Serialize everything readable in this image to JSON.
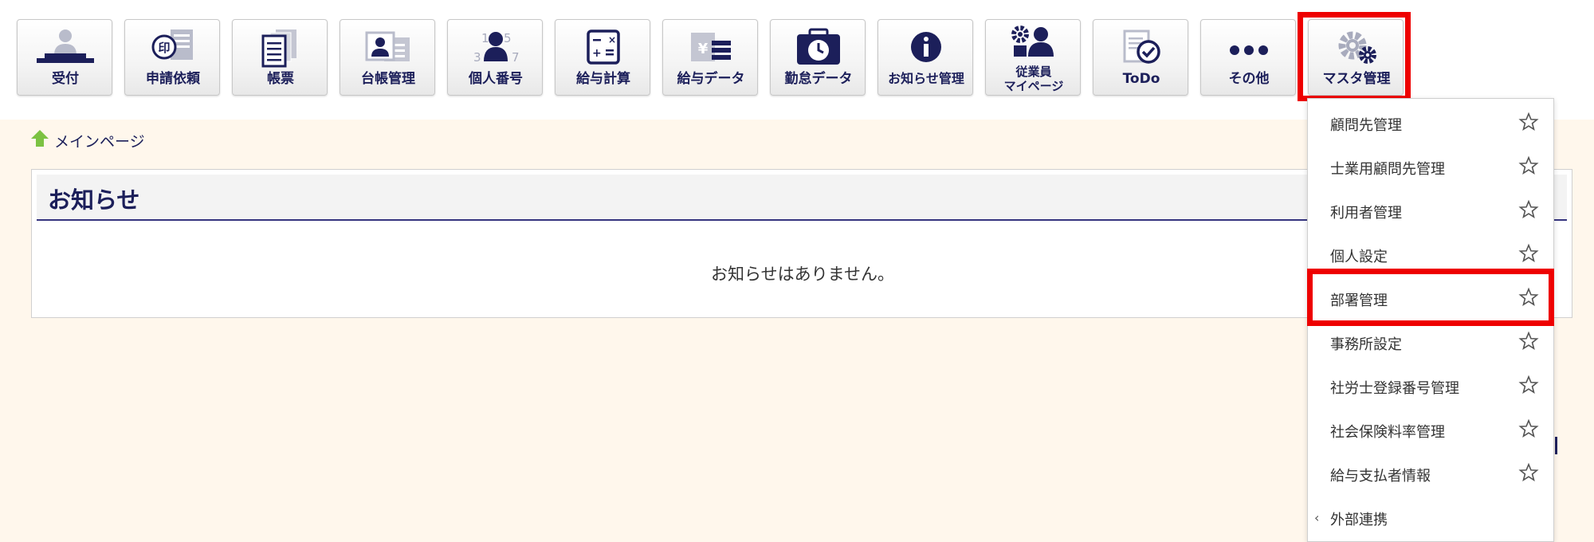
{
  "toolbar": {
    "buttons": [
      {
        "id": "uketsuke",
        "label": "受付",
        "icon": "reception-person-icon"
      },
      {
        "id": "shinsei",
        "label": "申請依頼",
        "icon": "stamp-document-icon"
      },
      {
        "id": "chohyo",
        "label": "帳票",
        "icon": "document-stack-icon"
      },
      {
        "id": "daicho",
        "label": "台帳管理",
        "icon": "id-card-icon"
      },
      {
        "id": "kojin",
        "label": "個人番号",
        "icon": "person-number-icon"
      },
      {
        "id": "kyuyo_keisan",
        "label": "給与計算",
        "icon": "calculator-icon"
      },
      {
        "id": "kyuyo_data",
        "label": "給与データ",
        "icon": "yen-data-icon"
      },
      {
        "id": "kintai",
        "label": "勤怠データ",
        "icon": "clock-bag-icon"
      },
      {
        "id": "oshirase",
        "label": "お知らせ管理",
        "icon": "info-icon"
      },
      {
        "id": "employee",
        "label": "従業員",
        "label2": "マイページ",
        "icon": "employee-gear-icon"
      },
      {
        "id": "todo",
        "label": "ToDo",
        "icon": "todo-check-icon"
      },
      {
        "id": "sonota",
        "label": "その他",
        "icon": "more-dots-icon"
      },
      {
        "id": "master",
        "label": "マスタ管理",
        "icon": "gears-icon"
      }
    ]
  },
  "breadcrumb": {
    "home_label": "メインページ"
  },
  "notice": {
    "title": "お知らせ",
    "empty_message": "お知らせはありません。"
  },
  "dropdown": {
    "items": [
      {
        "label": "顧問先管理"
      },
      {
        "label": "士業用顧問先管理"
      },
      {
        "label": "利用者管理"
      },
      {
        "label": "個人設定"
      },
      {
        "label": "部署管理"
      },
      {
        "label": "事務所設定"
      },
      {
        "label": "社労士登録番号管理"
      },
      {
        "label": "社会保険料率管理"
      },
      {
        "label": "給与支払者情報"
      }
    ],
    "submenu": {
      "label": "外部連携",
      "chevron": "‹"
    }
  },
  "colors": {
    "brand_navy": "#1c1f5a",
    "highlight_red": "#ee0000",
    "home_green": "#7cc242",
    "main_bg": "#fff7ec"
  }
}
